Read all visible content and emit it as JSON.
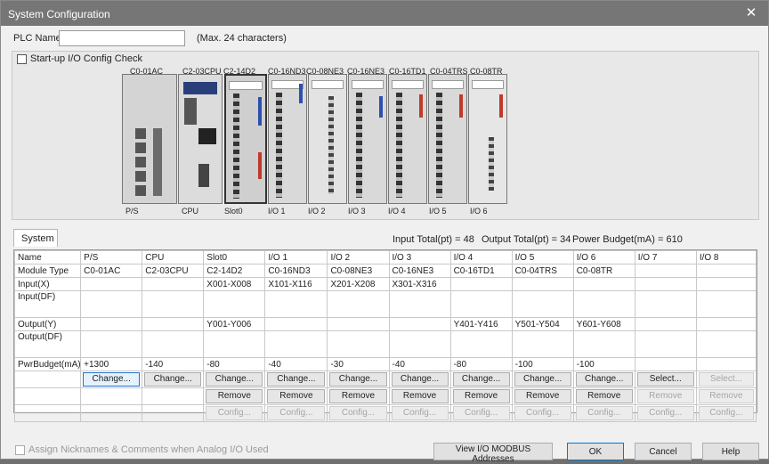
{
  "window": {
    "title": "System Configuration",
    "close_glyph": "✕"
  },
  "plc_name": {
    "label": "PLC Name",
    "value": "",
    "hint": "(Max. 24 characters)"
  },
  "startup_check": {
    "label": "Start-up I/O Config Check",
    "checked": false
  },
  "rack": {
    "module_names": [
      "C0-01AC",
      "C2-03CPU",
      "C2-14D2",
      "C0-16ND3",
      "C0-08NE3",
      "C0-16NE3",
      "C0-16TD1",
      "C0-04TRS",
      "C0-08TR"
    ],
    "slot_names": [
      "P/S",
      "CPU",
      "Slot0",
      "I/O 1",
      "I/O 2",
      "I/O 3",
      "I/O 4",
      "I/O 5",
      "I/O 6"
    ]
  },
  "tab": {
    "label": "System"
  },
  "totals": {
    "input": "Input Total(pt) = 48",
    "output": "Output Total(pt) = 34",
    "power": "Power Budget(mA) = 610"
  },
  "grid": {
    "headers": [
      "Name",
      "P/S",
      "CPU",
      "Slot0",
      "I/O 1",
      "I/O 2",
      "I/O 3",
      "I/O 4",
      "I/O 5",
      "I/O 6",
      "I/O 7",
      "I/O 8"
    ],
    "rows": [
      [
        "Module Type",
        "C0-01AC",
        "C2-03CPU",
        "C2-14D2",
        "C0-16ND3",
        "C0-08NE3",
        "C0-16NE3",
        "C0-16TD1",
        "C0-04TRS",
        "C0-08TR",
        "",
        ""
      ],
      [
        "Input(X)",
        "",
        "",
        "X001-X008",
        "X101-X116",
        "X201-X208",
        "X301-X316",
        "",
        "",
        "",
        "",
        ""
      ],
      [
        "Input(DF)",
        "",
        "",
        "",
        "",
        "",
        "",
        "",
        "",
        "",
        "",
        ""
      ],
      [
        "Output(Y)",
        "",
        "",
        "Y001-Y006",
        "",
        "",
        "",
        "Y401-Y416",
        "Y501-Y504",
        "Y601-Y608",
        "",
        ""
      ],
      [
        "Output(DF)",
        "",
        "",
        "",
        "",
        "",
        "",
        "",
        "",
        "",
        "",
        ""
      ],
      [
        "PwrBudget(mA)",
        "+1300",
        "-140",
        "-80",
        "-40",
        "-30",
        "-40",
        "-80",
        "-100",
        "-100",
        "",
        ""
      ]
    ],
    "change_label": "Change...",
    "select_label": "Select...",
    "remove_label": "Remove",
    "config_label": "Config..."
  },
  "bottom": {
    "nickname_label": "Assign Nicknames & Comments when Analog I/O Used",
    "view_modbus": "View I/O MODBUS Addresses",
    "ok": "OK",
    "cancel": "Cancel",
    "help": "Help"
  },
  "colors": {
    "titlebar": "#767676",
    "selected_button_border": "#2b73c9",
    "disabled_text": "#a5a5a5"
  }
}
